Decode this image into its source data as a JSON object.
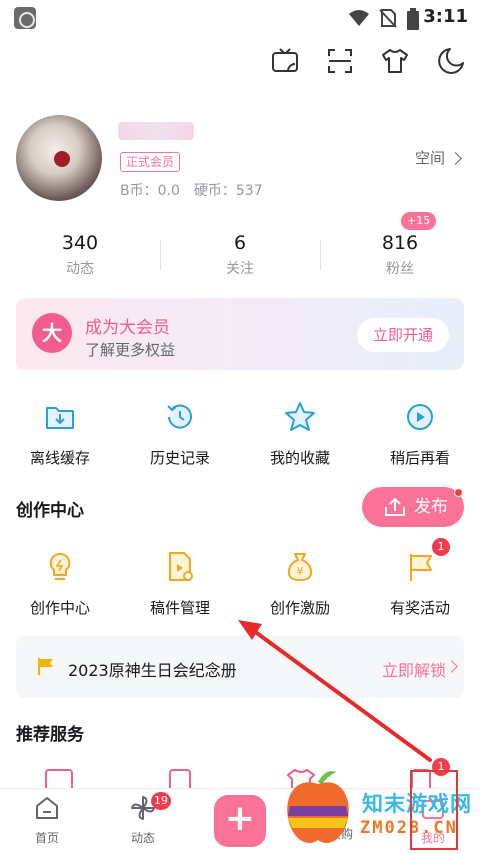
{
  "status_bar": {
    "time": "3:11"
  },
  "profile": {
    "vip_tag": "正式会员",
    "b_coin": "B币：0.0",
    "coin": "硬币：537",
    "space_label": "空间"
  },
  "stats": [
    {
      "num": "340",
      "label": "动态"
    },
    {
      "num": "6",
      "label": "关注"
    },
    {
      "num": "816",
      "label": "粉丝",
      "badge": "+15"
    }
  ],
  "vip_card": {
    "badge": "大",
    "title": "成为大会员",
    "subtitle": "了解更多权益",
    "button": "立即开通"
  },
  "quick_actions": [
    {
      "label": "离线缓存",
      "icon": "download-folder-icon"
    },
    {
      "label": "历史记录",
      "icon": "history-clock-icon"
    },
    {
      "label": "我的收藏",
      "icon": "star-icon"
    },
    {
      "label": "稍后再看",
      "icon": "watch-later-icon"
    }
  ],
  "creation": {
    "title": "创作中心",
    "publish_label": "发布",
    "items": [
      {
        "label": "创作中心",
        "icon": "lightbulb-icon"
      },
      {
        "label": "稿件管理",
        "icon": "manuscript-icon"
      },
      {
        "label": "创作激励",
        "icon": "money-bag-icon"
      },
      {
        "label": "有奖活动",
        "icon": "flag-icon",
        "badge": "1"
      }
    ]
  },
  "promo": {
    "text": "2023原神生日会纪念册",
    "link": "立即解锁"
  },
  "recommend": {
    "title": "推荐服务"
  },
  "bottom_nav": [
    {
      "label": "首页",
      "icon": "home-icon"
    },
    {
      "label": "动态",
      "icon": "pinwheel-icon",
      "badge": "19"
    },
    {
      "label": "",
      "icon": "plus-icon"
    },
    {
      "label": "会员购",
      "icon": "shopping-icon"
    },
    {
      "label": "我的",
      "icon": "profile-tv-icon",
      "badge": "1"
    }
  ],
  "watermark": {
    "line1": "知末游戏网",
    "line2": "ZM028.CN"
  },
  "colors": {
    "accent": "#fb7299",
    "vip_pink": "#f25d8e",
    "badge_red": "#f23c4c",
    "text_gray": "#9499a0"
  }
}
